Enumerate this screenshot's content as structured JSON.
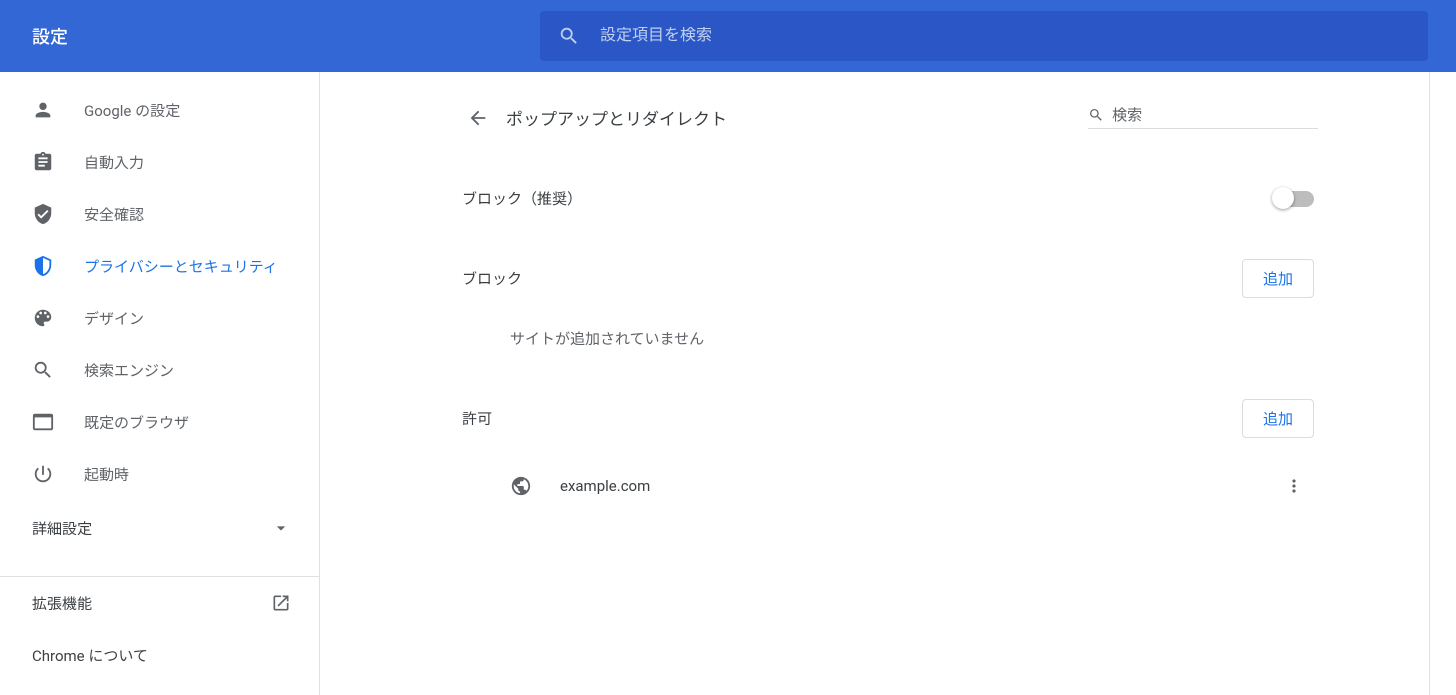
{
  "header": {
    "title": "設定",
    "search_placeholder": "設定項目を検索"
  },
  "sidebar": {
    "items": [
      {
        "icon": "person",
        "label": "Google の設定"
      },
      {
        "icon": "clipboard",
        "label": "自動入力"
      },
      {
        "icon": "check-shield",
        "label": "安全確認"
      },
      {
        "icon": "shield",
        "label": "プライバシーとセキュリティ",
        "active": true
      },
      {
        "icon": "palette",
        "label": "デザイン"
      },
      {
        "icon": "search",
        "label": "検索エンジン"
      },
      {
        "icon": "browser",
        "label": "既定のブラウザ"
      },
      {
        "icon": "power",
        "label": "起動時"
      }
    ],
    "advanced_label": "詳細設定",
    "extensions_label": "拡張機能",
    "about_label": "Chrome について"
  },
  "content": {
    "page_title": "ポップアップとリダイレクト",
    "search_placeholder": "検索",
    "block_recommended_label": "ブロック（推奨）",
    "block_toggle_on": false,
    "sections": {
      "block": {
        "label": "ブロック",
        "add_label": "追加",
        "empty_text": "サイトが追加されていません"
      },
      "allow": {
        "label": "許可",
        "add_label": "追加",
        "sites": [
          {
            "name": "example.com"
          }
        ]
      }
    }
  }
}
